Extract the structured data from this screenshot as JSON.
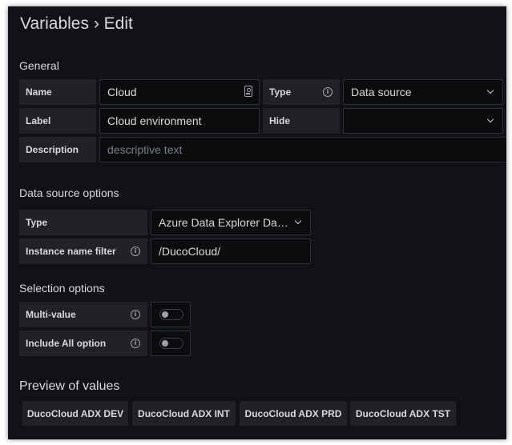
{
  "header": {
    "title": "Variables › Edit"
  },
  "general": {
    "heading": "General",
    "name_label": "Name",
    "name_value": "Cloud",
    "type_label": "Type",
    "type_value": "Data source",
    "label_label": "Label",
    "label_value": "Cloud environment",
    "hide_label": "Hide",
    "hide_value": "",
    "description_label": "Description",
    "description_placeholder": "descriptive text"
  },
  "datasource_options": {
    "heading": "Data source options",
    "type_label": "Type",
    "type_value": "Azure Data Explorer Da…",
    "instance_filter_label": "Instance name filter",
    "instance_filter_value": "/DucoCloud/"
  },
  "selection_options": {
    "heading": "Selection options",
    "multi_value_label": "Multi-value",
    "multi_value_enabled": false,
    "include_all_label": "Include All option",
    "include_all_enabled": false
  },
  "preview": {
    "heading": "Preview of values",
    "values": [
      "DucoCloud ADX DEV",
      "DucoCloud ADX INT",
      "DucoCloud ADX PRD",
      "DucoCloud ADX TST"
    ]
  },
  "icons": {
    "info": "info-circle-icon",
    "chevron": "chevron-down-icon",
    "key": "key-icon"
  }
}
